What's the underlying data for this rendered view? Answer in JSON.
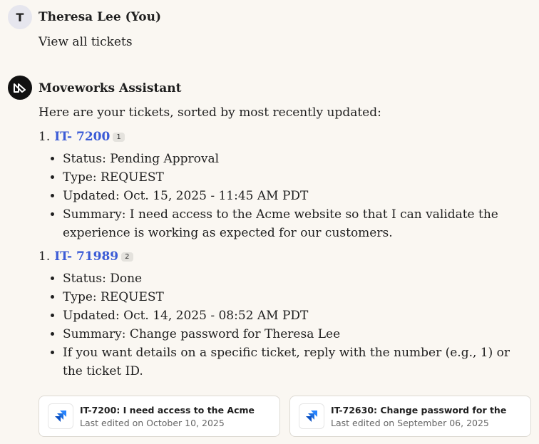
{
  "user": {
    "avatar_initial": "T",
    "name": "Theresa Lee (You)",
    "message": "View all tickets"
  },
  "assistant": {
    "name": "Moveworks Assistant",
    "intro": "Here are your tickets, sorted by most recently updated:",
    "tickets": [
      {
        "number": "1.",
        "id": "IT- 7200",
        "citation": "1",
        "bullets": [
          "Status: Pending Approval",
          "Type: REQUEST",
          "Updated: Oct. 15, 2025 - 11:45 AM PDT",
          "Summary: I need access to the Acme website so that I can validate the experience is working as expected for our customers."
        ]
      },
      {
        "number": "1.",
        "id": "IT- 71989",
        "citation": "2",
        "bullets": [
          "Status: Done",
          "Type: REQUEST",
          "Updated: Oct. 14, 2025 - 08:52 AM PDT",
          "Summary: Change password for Theresa Lee",
          "If you want details on a specific ticket, reply with the number (e.g., 1) or the ticket ID."
        ]
      }
    ],
    "cards": [
      {
        "title": "IT-7200: I need access to the Acme",
        "subtitle": "Last edited on October 10, 2025",
        "icon": "jira-icon"
      },
      {
        "title": "IT-72630: Change password for the",
        "subtitle": "Last edited on September 06, 2025",
        "icon": "jira-icon"
      }
    ]
  },
  "colors": {
    "background": "#faf7f2",
    "link": "#3b5bd6",
    "jira_blue": "#2684ff"
  }
}
